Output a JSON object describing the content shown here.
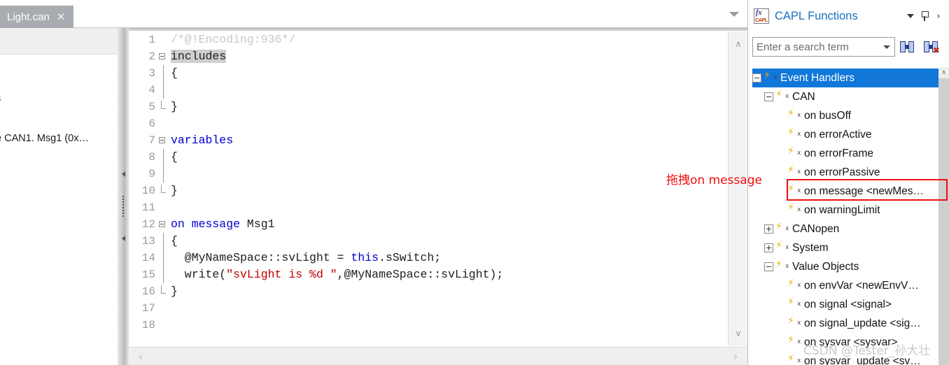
{
  "tabbar": {
    "tabs": [
      {
        "label": "Light.can",
        "close": "✕"
      }
    ],
    "dropdown_name": "tab-list-dropdown"
  },
  "left_panel": {
    "clipped_text_1": "s",
    "clipped_text_2": "e CAN1. Msg1 (0x…"
  },
  "editor": {
    "lines": [
      {
        "num": "1",
        "fold": "none",
        "guide": "none",
        "segments": [
          {
            "text": "/*@!Encoding:936*/",
            "cls": "cm"
          }
        ]
      },
      {
        "num": "2",
        "fold": "minus",
        "guide": "none",
        "segments": [
          {
            "text": "includes",
            "cls": "sel"
          }
        ]
      },
      {
        "num": "3",
        "fold": "none",
        "guide": "bar",
        "segments": [
          {
            "text": "{",
            "cls": "pl"
          }
        ]
      },
      {
        "num": "4",
        "fold": "none",
        "guide": "bar",
        "segments": [
          {
            "text": "",
            "cls": "pl"
          }
        ]
      },
      {
        "num": "5",
        "fold": "none",
        "guide": "end",
        "segments": [
          {
            "text": "}",
            "cls": "pl"
          }
        ]
      },
      {
        "num": "6",
        "fold": "none",
        "guide": "none",
        "segments": [
          {
            "text": "",
            "cls": "pl"
          }
        ]
      },
      {
        "num": "7",
        "fold": "minus",
        "guide": "none",
        "segments": [
          {
            "text": "variables",
            "cls": "kw"
          }
        ]
      },
      {
        "num": "8",
        "fold": "none",
        "guide": "bar",
        "segments": [
          {
            "text": "{",
            "cls": "pl"
          }
        ]
      },
      {
        "num": "9",
        "fold": "none",
        "guide": "bar",
        "segments": [
          {
            "text": "",
            "cls": "pl"
          }
        ]
      },
      {
        "num": "10",
        "fold": "none",
        "guide": "end",
        "segments": [
          {
            "text": "}",
            "cls": "pl"
          }
        ]
      },
      {
        "num": "11",
        "fold": "none",
        "guide": "none",
        "segments": [
          {
            "text": "",
            "cls": "pl"
          }
        ]
      },
      {
        "num": "12",
        "fold": "minus",
        "guide": "none",
        "segments": [
          {
            "text": "on message ",
            "cls": "kw"
          },
          {
            "text": "Msg1",
            "cls": "pl"
          }
        ]
      },
      {
        "num": "13",
        "fold": "none",
        "guide": "bar",
        "segments": [
          {
            "text": "{",
            "cls": "pl"
          }
        ]
      },
      {
        "num": "14",
        "fold": "none",
        "guide": "bar",
        "segments": [
          {
            "text": "  @MyNameSpace::svLight = ",
            "cls": "pl"
          },
          {
            "text": "this",
            "cls": "kw"
          },
          {
            "text": ".sSwitch;",
            "cls": "pl"
          }
        ]
      },
      {
        "num": "15",
        "fold": "none",
        "guide": "bar",
        "segments": [
          {
            "text": "  write(",
            "cls": "pl"
          },
          {
            "text": "\"svLight is %d \"",
            "cls": "str"
          },
          {
            "text": ",@MyNameSpace::svLight);",
            "cls": "pl"
          }
        ]
      },
      {
        "num": "16",
        "fold": "none",
        "guide": "end",
        "segments": [
          {
            "text": "}",
            "cls": "pl"
          }
        ]
      },
      {
        "num": "17",
        "fold": "none",
        "guide": "none",
        "segments": [
          {
            "text": "",
            "cls": "pl"
          }
        ]
      },
      {
        "num": "18",
        "fold": "none",
        "guide": "none",
        "segments": [
          {
            "text": "",
            "cls": "pl"
          }
        ]
      }
    ],
    "vscroll": {
      "up": "∧",
      "down": "∨"
    },
    "hscroll": {
      "left": "‹",
      "right": "›"
    }
  },
  "annotation": {
    "text": "拖拽on message",
    "color": "#f20d0d"
  },
  "right_panel": {
    "title": "CAPL Functions",
    "icon_name": "capl-functions-icon",
    "icon_fx": "fx",
    "icon_capl": "CAPL",
    "header_buttons": [
      {
        "name": "panel-menu-dropdown",
        "glyph": ""
      },
      {
        "name": "pin-panel-button",
        "glyph": ""
      },
      {
        "name": "close-panel-button",
        "glyph": "›"
      }
    ],
    "search": {
      "placeholder": "Enter a search term",
      "value": "Enter a search term",
      "find_button": "find-button",
      "clear_button": "clear-search-button"
    },
    "tree": [
      {
        "label": "Event Handlers",
        "indent": 0,
        "expander": "minus",
        "selected": true
      },
      {
        "label": "CAN",
        "indent": 1,
        "expander": "minus",
        "selected": false
      },
      {
        "label": "on busOff",
        "indent": 2,
        "expander": "none",
        "selected": false
      },
      {
        "label": "on errorActive",
        "indent": 2,
        "expander": "none",
        "selected": false
      },
      {
        "label": "on errorFrame",
        "indent": 2,
        "expander": "none",
        "selected": false
      },
      {
        "label": "on errorPassive",
        "indent": 2,
        "expander": "none",
        "selected": false
      },
      {
        "label": "on message <newMes…",
        "indent": 2,
        "expander": "none",
        "selected": false,
        "highlighted": true
      },
      {
        "label": "on warningLimit",
        "indent": 2,
        "expander": "none",
        "selected": false
      },
      {
        "label": "CANopen",
        "indent": 1,
        "expander": "plus",
        "selected": false
      },
      {
        "label": "System",
        "indent": 1,
        "expander": "plus",
        "selected": false
      },
      {
        "label": "Value Objects",
        "indent": 1,
        "expander": "minus",
        "selected": false
      },
      {
        "label": "on envVar <newEnvV…",
        "indent": 2,
        "expander": "none",
        "selected": false
      },
      {
        "label": "on signal <signal>",
        "indent": 2,
        "expander": "none",
        "selected": false
      },
      {
        "label": "on signal_update <sig…",
        "indent": 2,
        "expander": "none",
        "selected": false
      },
      {
        "label": "on sysvar <sysvar>",
        "indent": 2,
        "expander": "none",
        "selected": false
      },
      {
        "label": "on sysvar_update <sv…",
        "indent": 2,
        "expander": "none",
        "selected": false
      }
    ],
    "scroll_up": "∧"
  },
  "watermark": {
    "text": "CSDN @Tester_孙大壮"
  },
  "colors": {
    "accent_blue": "#1177d8",
    "title_blue": "#1670c0",
    "annotation_red": "#f20d0d",
    "keyword_blue": "#0000d0",
    "string_red": "#c00000",
    "tab_gray": "#a8acb0"
  }
}
